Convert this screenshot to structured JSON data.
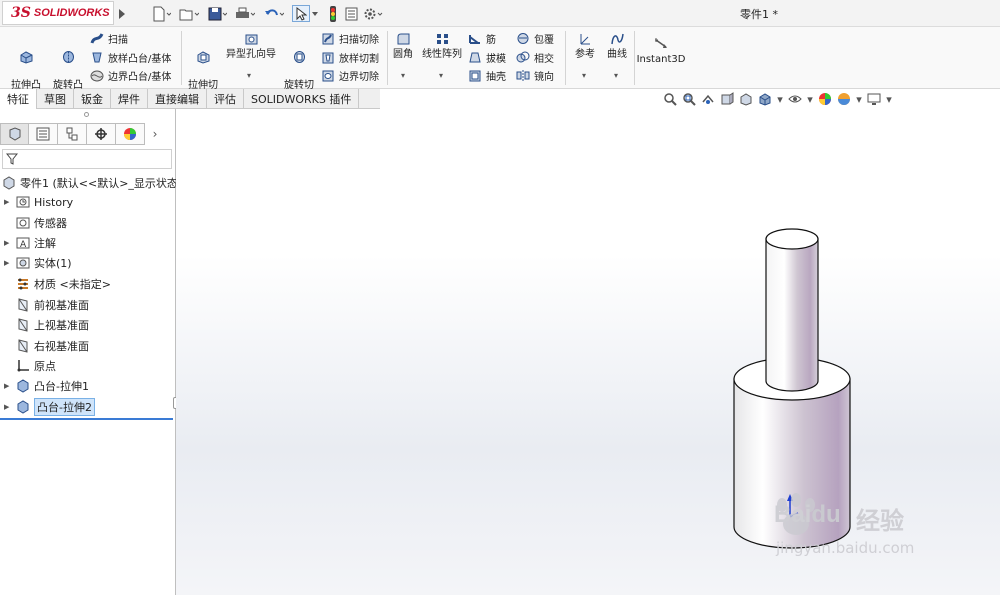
{
  "app": {
    "brand_mark": "3S",
    "brand_name": "SOLIDWORKS",
    "doc_title": "零件1 *"
  },
  "ribbon": {
    "extrude_boss": "拉伸凸\n台/基体",
    "revolve_boss": "旋转凸\n台/基体",
    "sweep": "扫描",
    "loft_boss": "放样凸台/基体",
    "boundary_boss": "边界凸台/基体",
    "extrude_cut": "拉伸切\n除",
    "hole_wizard": "异型孔向导",
    "revolve_cut": "旋转切\n除",
    "swept_cut": "扫描切除",
    "lofted_cut": "放样切割",
    "boundary_cut": "边界切除",
    "fillet": "圆角",
    "linear_pattern": "线性阵列",
    "rib": "筋",
    "draft": "拔模",
    "shell": "抽壳",
    "wrap": "包覆",
    "intersect": "相交",
    "mirror": "镜向",
    "reference": "参考",
    "curves": "曲线",
    "instant3d": "Instant3D"
  },
  "tabs": [
    "特征",
    "草图",
    "钣金",
    "焊件",
    "直接编辑",
    "评估",
    "SOLIDWORKS 插件"
  ],
  "tree": {
    "root": "零件1 (默认<<默认>_显示状态",
    "items": [
      {
        "label": "History",
        "expandable": true
      },
      {
        "label": "传感器",
        "expandable": false
      },
      {
        "label": "注解",
        "expandable": true
      },
      {
        "label": "实体(1)",
        "expandable": true
      },
      {
        "label": "材质 <未指定>",
        "expandable": false
      },
      {
        "label": "前视基准面",
        "expandable": false
      },
      {
        "label": "上视基准面",
        "expandable": false
      },
      {
        "label": "右视基准面",
        "expandable": false
      },
      {
        "label": "原点",
        "expandable": false
      },
      {
        "label": "凸台-拉伸1",
        "expandable": true
      },
      {
        "label": "凸台-拉伸2",
        "expandable": true,
        "selected": true
      }
    ]
  },
  "watermark": {
    "brand": "Bai",
    "brand2": "du",
    "cn": "经验",
    "url": "jingyan.baidu.com"
  },
  "colors": {
    "brand_red": "#c8102e",
    "selection_blue": "#3a7bd5",
    "axis_blue": "#1f3fd0"
  }
}
